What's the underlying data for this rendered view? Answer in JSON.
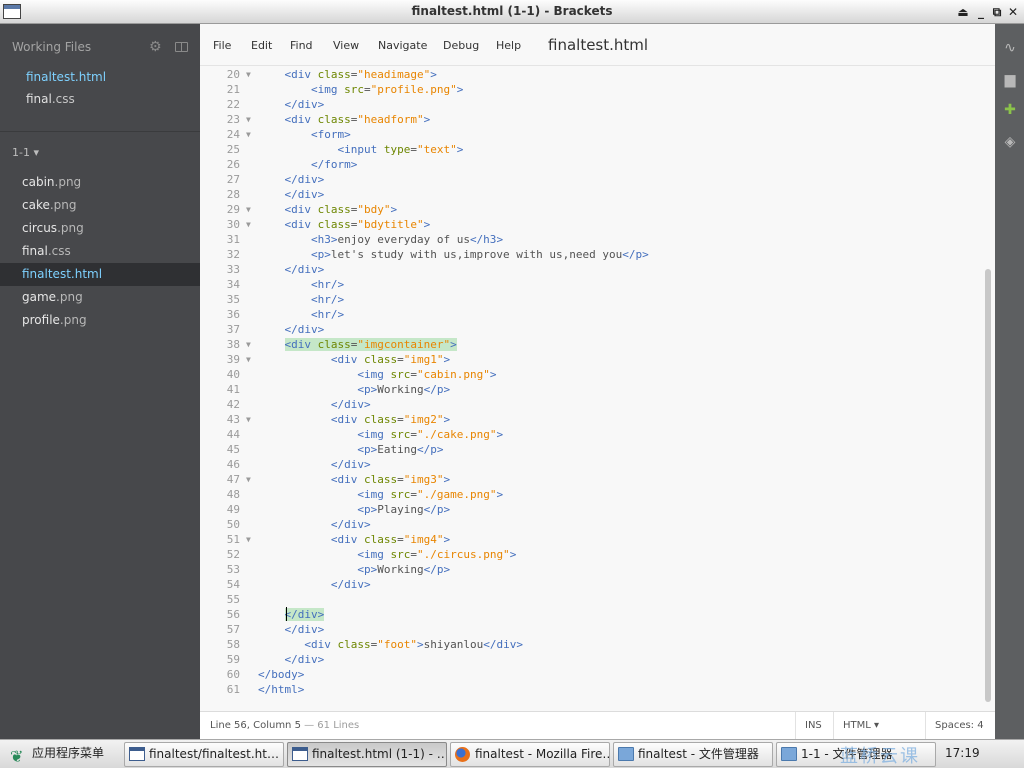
{
  "window": {
    "title": "finaltest.html (1-1) - Brackets",
    "controls": [
      "⏏",
      "_",
      "⧉",
      "✕"
    ]
  },
  "sidebar": {
    "working_files_header": "Working Files",
    "working_files": [
      {
        "name": "finaltest",
        "ext": ".html",
        "active": true
      },
      {
        "name": "final",
        "ext": ".css",
        "active": false
      }
    ],
    "project_name": "1-1 ▾",
    "tree": [
      {
        "name": "cabin",
        "ext": ".png"
      },
      {
        "name": "cake",
        "ext": ".png"
      },
      {
        "name": "circus",
        "ext": ".png"
      },
      {
        "name": "final",
        "ext": ".css"
      },
      {
        "name": "finaltest",
        "ext": ".html",
        "selected": true
      },
      {
        "name": "game",
        "ext": ".png"
      },
      {
        "name": "profile",
        "ext": ".png"
      }
    ]
  },
  "menu": {
    "items": [
      "File",
      "Edit",
      "Find",
      "View",
      "Navigate",
      "Debug",
      "Help"
    ],
    "document_title": "finaltest.html"
  },
  "editor": {
    "lines": [
      {
        "n": "20",
        "fold": true,
        "text": "    <div class=\"headimage\">"
      },
      {
        "n": "21",
        "fold": false,
        "text": "        <img src=\"profile.png\">"
      },
      {
        "n": "22",
        "fold": false,
        "text": "    </div>"
      },
      {
        "n": "23",
        "fold": true,
        "text": "    <div class=\"headform\">"
      },
      {
        "n": "24",
        "fold": true,
        "text": "        <form>"
      },
      {
        "n": "25",
        "fold": false,
        "text": "            <input type=\"text\">"
      },
      {
        "n": "26",
        "fold": false,
        "text": "        </form>"
      },
      {
        "n": "27",
        "fold": false,
        "text": "    </div>"
      },
      {
        "n": "28",
        "fold": false,
        "text": "    </div>"
      },
      {
        "n": "29",
        "fold": true,
        "text": "    <div class=\"bdy\">"
      },
      {
        "n": "30",
        "fold": true,
        "text": "    <div class=\"bdytitle\">"
      },
      {
        "n": "31",
        "fold": false,
        "text": "        <h3>enjoy everyday of us</h3>"
      },
      {
        "n": "32",
        "fold": false,
        "text": "        <p>let's study with us,improve with us,need you</p>"
      },
      {
        "n": "33",
        "fold": false,
        "text": "    </div>"
      },
      {
        "n": "34",
        "fold": false,
        "text": "        <hr/>"
      },
      {
        "n": "35",
        "fold": false,
        "text": "        <hr/>"
      },
      {
        "n": "36",
        "fold": false,
        "text": "        <hr/>"
      },
      {
        "n": "37",
        "fold": false,
        "text": "    </div>"
      },
      {
        "n": "38",
        "fold": true,
        "text": "    <div class=\"imgcontainer\">",
        "match": true
      },
      {
        "n": "39",
        "fold": true,
        "text": "           <div class=\"img1\">"
      },
      {
        "n": "40",
        "fold": false,
        "text": "               <img src=\"cabin.png\">"
      },
      {
        "n": "41",
        "fold": false,
        "text": "               <p>Working</p>"
      },
      {
        "n": "42",
        "fold": false,
        "text": "           </div>"
      },
      {
        "n": "43",
        "fold": true,
        "text": "           <div class=\"img2\">"
      },
      {
        "n": "44",
        "fold": false,
        "text": "               <img src=\"./cake.png\">"
      },
      {
        "n": "45",
        "fold": false,
        "text": "               <p>Eating</p>"
      },
      {
        "n": "46",
        "fold": false,
        "text": "           </div>"
      },
      {
        "n": "47",
        "fold": true,
        "text": "           <div class=\"img3\">"
      },
      {
        "n": "48",
        "fold": false,
        "text": "               <img src=\"./game.png\">"
      },
      {
        "n": "49",
        "fold": false,
        "text": "               <p>Playing</p>"
      },
      {
        "n": "50",
        "fold": false,
        "text": "           </div>"
      },
      {
        "n": "51",
        "fold": true,
        "text": "           <div class=\"img4\">"
      },
      {
        "n": "52",
        "fold": false,
        "text": "               <img src=\"./circus.png\">"
      },
      {
        "n": "53",
        "fold": false,
        "text": "               <p>Working</p>"
      },
      {
        "n": "54",
        "fold": false,
        "text": "           </div>"
      },
      {
        "n": "55",
        "fold": false,
        "text": ""
      },
      {
        "n": "56",
        "fold": false,
        "text": "    </div>",
        "match": true
      },
      {
        "n": "57",
        "fold": false,
        "text": "    </div>"
      },
      {
        "n": "58",
        "fold": false,
        "text": "       <div class=\"foot\">shiyanlou</div>"
      },
      {
        "n": "59",
        "fold": false,
        "text": "    </div>"
      },
      {
        "n": "60",
        "fold": false,
        "text": "</body>"
      },
      {
        "n": "61",
        "fold": false,
        "text": "</html>"
      }
    ]
  },
  "status": {
    "position": "Line 56, Column 5",
    "line_count": " — 61 Lines",
    "mode": "INS",
    "language": "HTML ▾",
    "spaces_label": "Spaces:  4"
  },
  "right_toolbar": {
    "icons": [
      "live-preview-icon",
      "extension-manager-icon",
      "extension-gift-icon",
      "layers-icon"
    ]
  },
  "taskbar": {
    "start_label": "应用程序菜单",
    "tasks": [
      {
        "label": "finaltest/finaltest.ht…",
        "icon": "window-icon",
        "pressed": false
      },
      {
        "label": "finaltest.html (1-1) - …",
        "icon": "window-icon",
        "pressed": true
      },
      {
        "label": "finaltest - Mozilla Fire…",
        "icon": "firefox-icon",
        "pressed": false
      },
      {
        "label": "finaltest - 文件管理器",
        "icon": "folder-icon",
        "pressed": false
      },
      {
        "label": "1-1 - 文件管理器",
        "icon": "folder-icon",
        "pressed": false
      }
    ],
    "clock": "17:19",
    "watermark": "蓝桥云课"
  }
}
